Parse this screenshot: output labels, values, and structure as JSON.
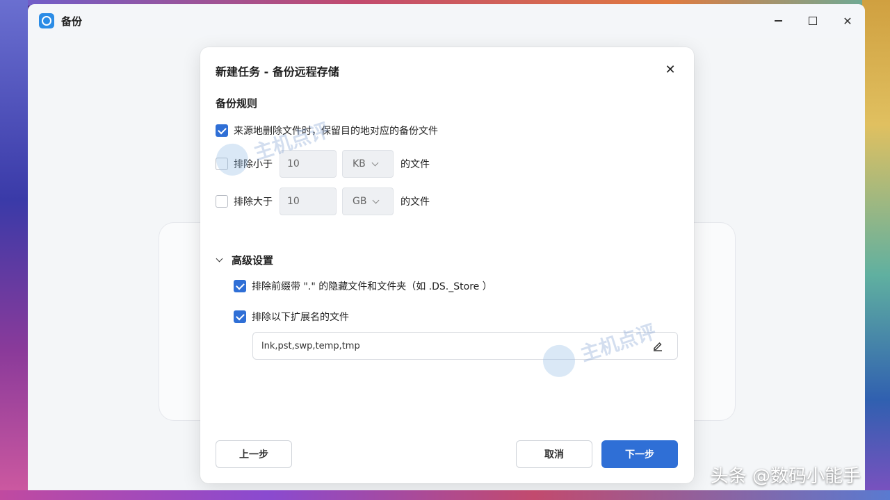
{
  "window": {
    "title": "备份",
    "controls": [
      "minimize-icon",
      "maximize-icon",
      "close-icon"
    ],
    "close_glyph": "✕"
  },
  "modal": {
    "title": "新建任务 - 备份远程存储",
    "close_glyph": "✕",
    "section_title": "备份规则",
    "keep_on_delete": {
      "label": "来源地删除文件时，保留目的地对应的备份文件",
      "checked": true
    },
    "exclude_smaller": {
      "label": "排除小于",
      "checked": false,
      "value": "10",
      "unit": "KB",
      "suffix": "的文件"
    },
    "exclude_larger": {
      "label": "排除大于",
      "checked": false,
      "value": "10",
      "unit": "GB",
      "suffix": "的文件"
    },
    "advanced": {
      "label": "高级设置",
      "exclude_hidden": {
        "label": "排除前缀带 \".\" 的隐藏文件和文件夹（如 .DS._Store ）",
        "checked": true
      },
      "exclude_ext": {
        "label": "排除以下扩展名的文件",
        "checked": true
      },
      "ext_value": "lnk,pst,swp,temp,tmp"
    },
    "buttons": {
      "prev": "上一步",
      "cancel": "取消",
      "next": "下一步"
    }
  },
  "watermarks": {
    "site": "主机点评",
    "footer": "头条 @数码小能手"
  },
  "colors": {
    "accent": "#2f6fd6"
  }
}
